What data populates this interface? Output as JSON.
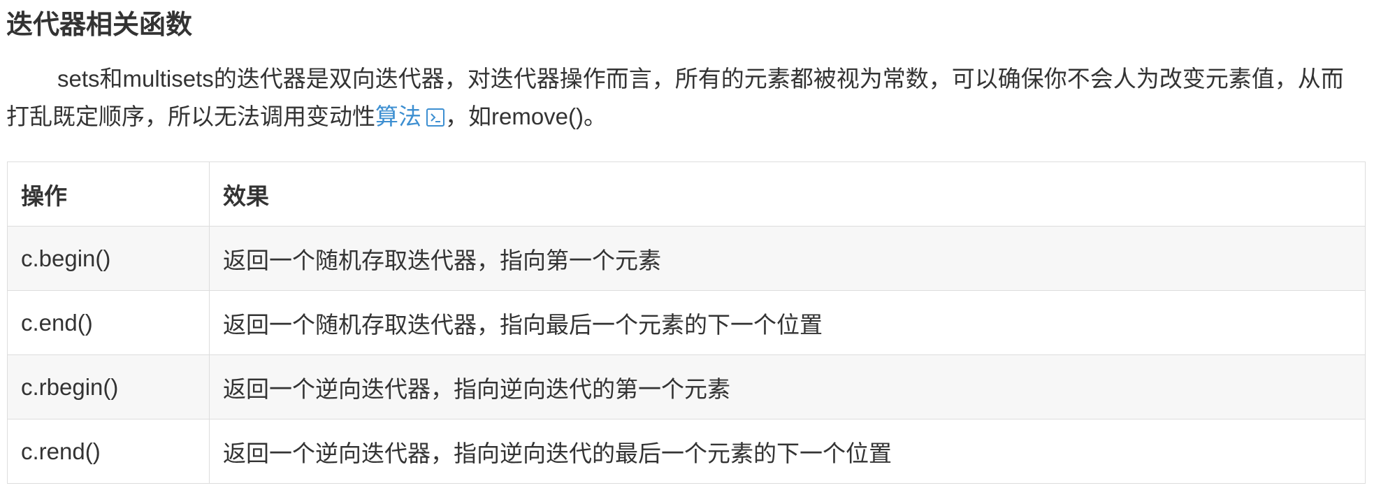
{
  "heading": "迭代器相关函数",
  "paragraph": {
    "text_before": "sets和multisets的迭代器是双向迭代器，对迭代器操作而言，所有的元素都被视为常数，可以确保你不会人为改变元素值，从而打乱既定顺序，所以无法调用变动性",
    "link_text": "算法",
    "link_icon": "external-link-icon",
    "text_after": "，如remove()。"
  },
  "table": {
    "headers": [
      "操作",
      "效果"
    ],
    "rows": [
      {
        "op": "c.begin()",
        "effect": "返回一个随机存取迭代器，指向第一个元素"
      },
      {
        "op": "c.end()",
        "effect": "返回一个随机存取迭代器，指向最后一个元素的下一个位置"
      },
      {
        "op": "c.rbegin()",
        "effect": "返回一个逆向迭代器，指向逆向迭代的第一个元素"
      },
      {
        "op": "c.rend()",
        "effect": "返回一个逆向迭代器，指向逆向迭代的最后一个元素的下一个位置"
      }
    ]
  },
  "colors": {
    "text": "#333333",
    "link": "#3d8fd1",
    "table_border": "#dddddd",
    "row_stripe": "#f7f7f7"
  }
}
